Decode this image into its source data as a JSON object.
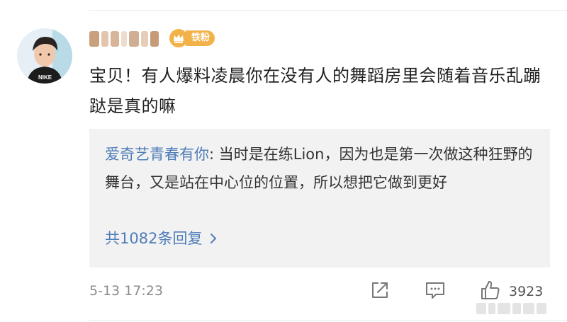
{
  "post": {
    "username": "",
    "badge_label": "铁粉",
    "comment_text": "宝贝！有人爆料凌晨你在没有人的舞蹈房里会随着音乐乱蹦跶是真的嘛"
  },
  "reply": {
    "author": "爱奇艺青春有你",
    "separator": ": ",
    "text": "当时是在练Lion，因为也是第一次做这种狂野的舞台，又是站在中心位的位置，所以想把它做到更好",
    "count_label": "共1082条回复"
  },
  "meta": {
    "timestamp": "5-13 17:23",
    "like_count": "3923"
  },
  "colors": {
    "link_blue": "#4f7db8",
    "badge_orange": "#f2b24a",
    "reply_bg": "#f2f2f2"
  },
  "icons": {
    "share": "share-icon",
    "comment": "comment-icon",
    "like": "thumbs-up-icon",
    "crown": "crown-icon",
    "chevron": "chevron-right-icon"
  }
}
